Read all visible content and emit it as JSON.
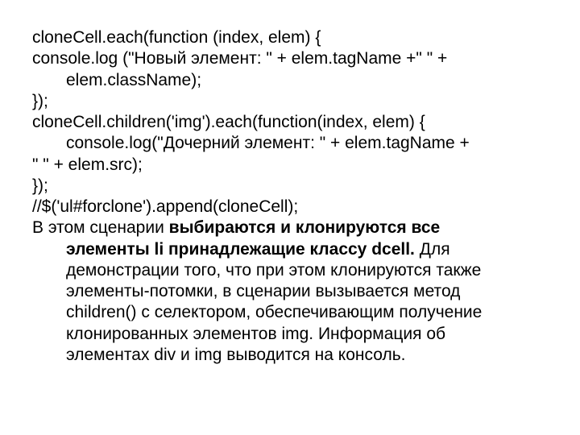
{
  "code": {
    "l1": "cloneCell.each(function (index, elem) {",
    "l2a": "console.log (\"Новый элемент: \" + elem.tagName +\" \" +",
    "l2b": "elem.className);",
    "l3": "});",
    "l4a": "cloneCell.children('img').each(function(index, elem) {",
    "l4b": "console.log(\"Дочерний элемент: \" + elem.tagName +",
    "l5": "\" \" + elem.src);",
    "l6": "});",
    "l7": "//$('ul#forclone').append(cloneCell);"
  },
  "text": {
    "p1_lead": "В этом сценарии ",
    "p1_bold": "выбираются и клонируются все",
    "p2_bold": "элементы li принадлежащие классу dcell.",
    "p2_rest": " Для",
    "p3": "демонстрации того, что при этом клонируются также",
    "p4": "элементы-потомки, в сценарии вызывается метод",
    "p5": "children() с селектором, обеспечивающим получение",
    "p6": "клонированных элементов img. Информация об",
    "p7": "элементах div и img выводится на консоль."
  }
}
